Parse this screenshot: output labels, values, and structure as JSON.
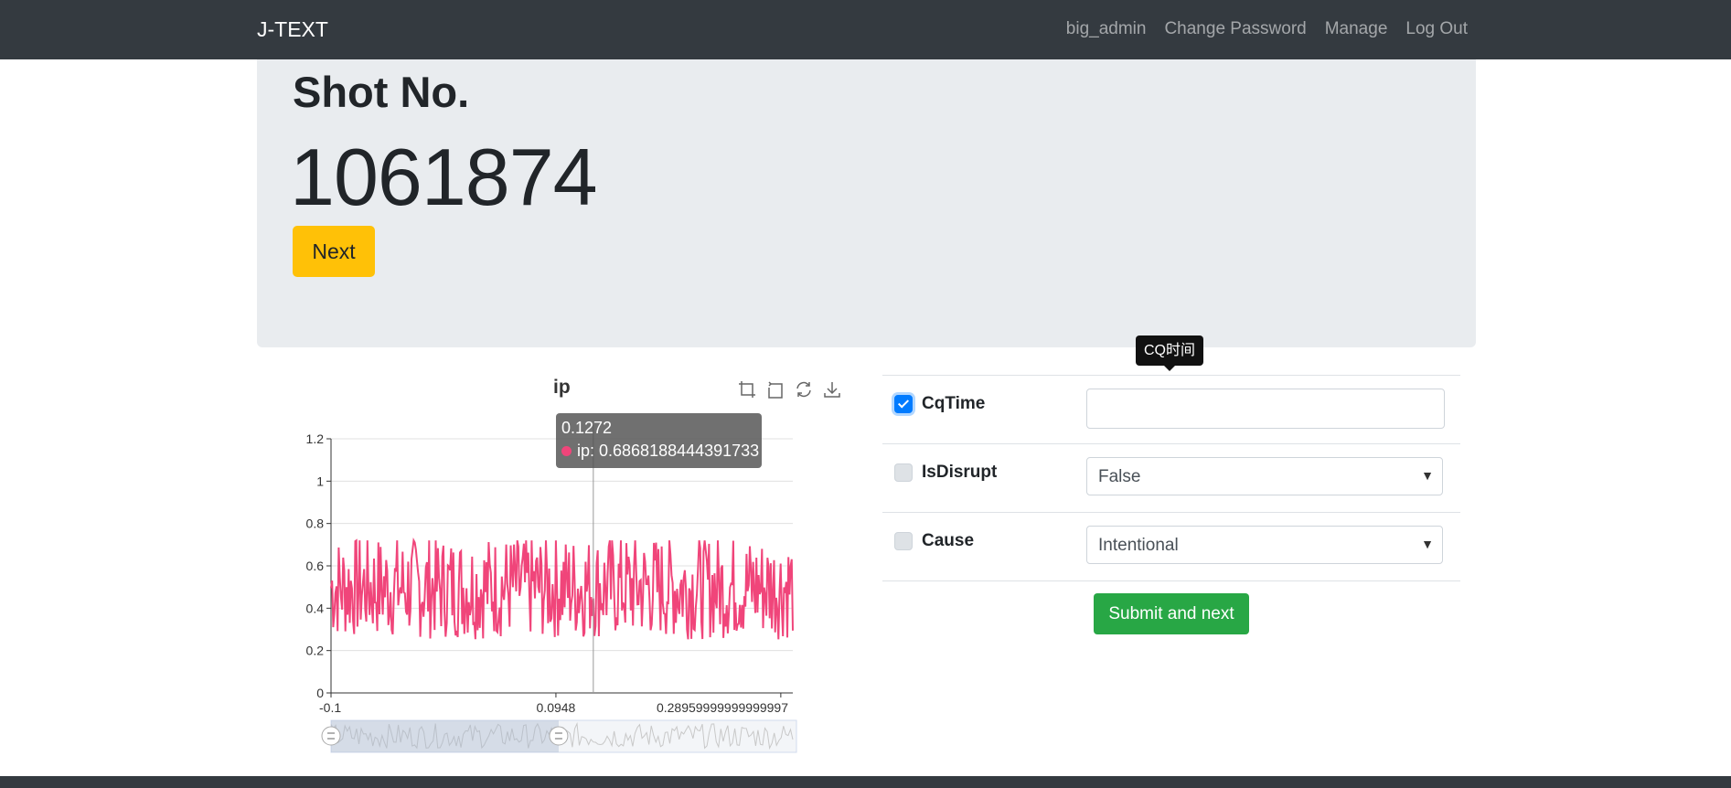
{
  "navbar": {
    "brand": "J-TEXT",
    "links": [
      "big_admin",
      "Change Password",
      "Manage",
      "Log Out"
    ]
  },
  "jumbotron": {
    "title": "Shot No.",
    "shot_number": "1061874",
    "next_label": "Next"
  },
  "chart_data": {
    "type": "line",
    "title": "ip",
    "series": [
      {
        "name": "ip",
        "color": "#f0457a"
      }
    ],
    "x_tick_labels": [
      "-0.1",
      "0.0948",
      "0.28959999999999997"
    ],
    "y_tick_labels": [
      "0",
      "0.2",
      "0.4",
      "0.6",
      "0.8",
      "1",
      "1.2"
    ],
    "ylim": [
      0,
      1.2
    ],
    "xlim": [
      -0.1,
      0.3
    ],
    "value_range": [
      0.25,
      0.72
    ],
    "mean_value": 0.5,
    "grid": true,
    "tooltip": {
      "x": "0.1272",
      "label": "ip: 0.6868188444391733"
    },
    "toolbox_icons": [
      "zoom-icon",
      "zoom-reset-icon",
      "restore-icon",
      "save-image-icon"
    ]
  },
  "form": {
    "tooltip": "CQ时间",
    "rows": [
      {
        "label": "CqTime",
        "checked": true,
        "value": ""
      },
      {
        "label": "IsDisrupt",
        "checked": false,
        "value": "False"
      },
      {
        "label": "Cause",
        "checked": false,
        "value": "Intentional"
      }
    ],
    "submit_label": "Submit and next"
  }
}
